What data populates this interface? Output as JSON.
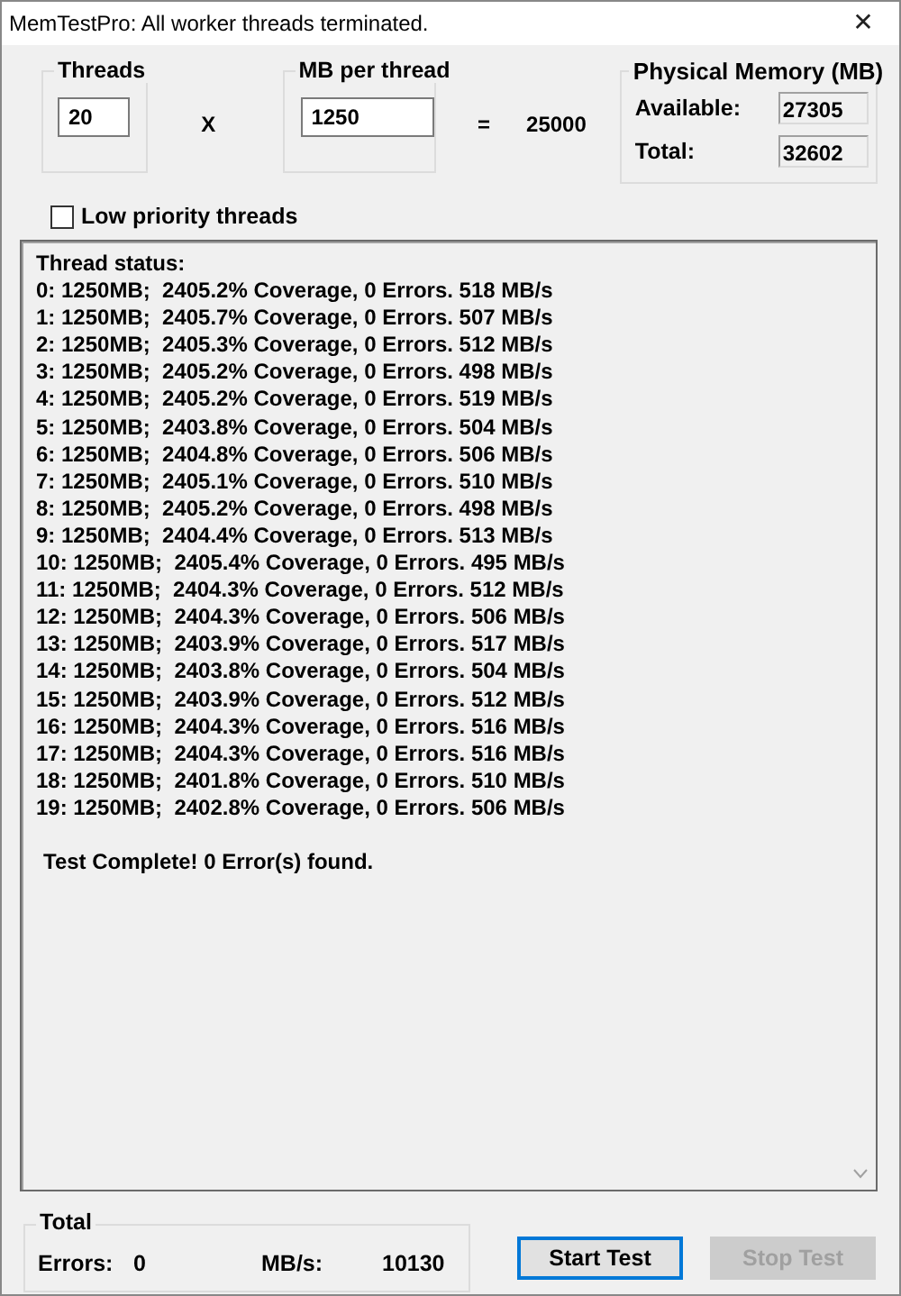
{
  "window": {
    "title": "MemTestPro: All worker threads terminated.",
    "close": "✕"
  },
  "threads": {
    "label": "Threads",
    "value": "20"
  },
  "times": "X",
  "mb_per_thread": {
    "label": "MB per thread",
    "value": "1250"
  },
  "equals": "=",
  "product": "25000",
  "physical_memory": {
    "label": "Physical Memory (MB)",
    "fields": [
      {
        "label": "Available:",
        "value": "27305"
      },
      {
        "label": "Total:",
        "value": "32602"
      }
    ]
  },
  "low_priority": {
    "label": "Low priority threads",
    "checked": false
  },
  "log": {
    "lines": [
      "Thread status:",
      "0: 1250MB;  2405.2% Coverage, 0 Errors. 518 MB/s",
      "1: 1250MB;  2405.7% Coverage, 0 Errors. 507 MB/s",
      "2: 1250MB;  2405.3% Coverage, 0 Errors. 512 MB/s",
      "3: 1250MB;  2405.2% Coverage, 0 Errors. 498 MB/s",
      "4: 1250MB;  2405.2% Coverage, 0 Errors. 519 MB/s",
      "5: 1250MB;  2403.8% Coverage, 0 Errors. 504 MB/s",
      "6: 1250MB;  2404.8% Coverage, 0 Errors. 506 MB/s",
      "7: 1250MB;  2405.1% Coverage, 0 Errors. 510 MB/s",
      "8: 1250MB;  2405.2% Coverage, 0 Errors. 498 MB/s",
      "9: 1250MB;  2404.4% Coverage, 0 Errors. 513 MB/s",
      "10: 1250MB;  2405.4% Coverage, 0 Errors. 495 MB/s",
      "11: 1250MB;  2404.3% Coverage, 0 Errors. 512 MB/s",
      "12: 1250MB;  2404.3% Coverage, 0 Errors. 506 MB/s",
      "13: 1250MB;  2403.9% Coverage, 0 Errors. 517 MB/s",
      "14: 1250MB;  2403.8% Coverage, 0 Errors. 504 MB/s",
      "15: 1250MB;  2403.9% Coverage, 0 Errors. 512 MB/s",
      "16: 1250MB;  2404.3% Coverage, 0 Errors. 516 MB/s",
      "17: 1250MB;  2404.3% Coverage, 0 Errors. 516 MB/s",
      "18: 1250MB;  2401.8% Coverage, 0 Errors. 510 MB/s",
      "19: 1250MB;  2402.8% Coverage, 0 Errors. 506 MB/s"
    ],
    "summary": "Test Complete! 0 Error(s) found."
  },
  "total": {
    "label": "Total",
    "errors_label": "Errors:",
    "errors": "0",
    "rate_label": "MB/s:",
    "rate": "10130"
  },
  "buttons": [
    {
      "label": "Start Test",
      "disabled": false,
      "focused": true
    },
    {
      "label": "Stop Test",
      "disabled": true,
      "focused": false
    }
  ]
}
